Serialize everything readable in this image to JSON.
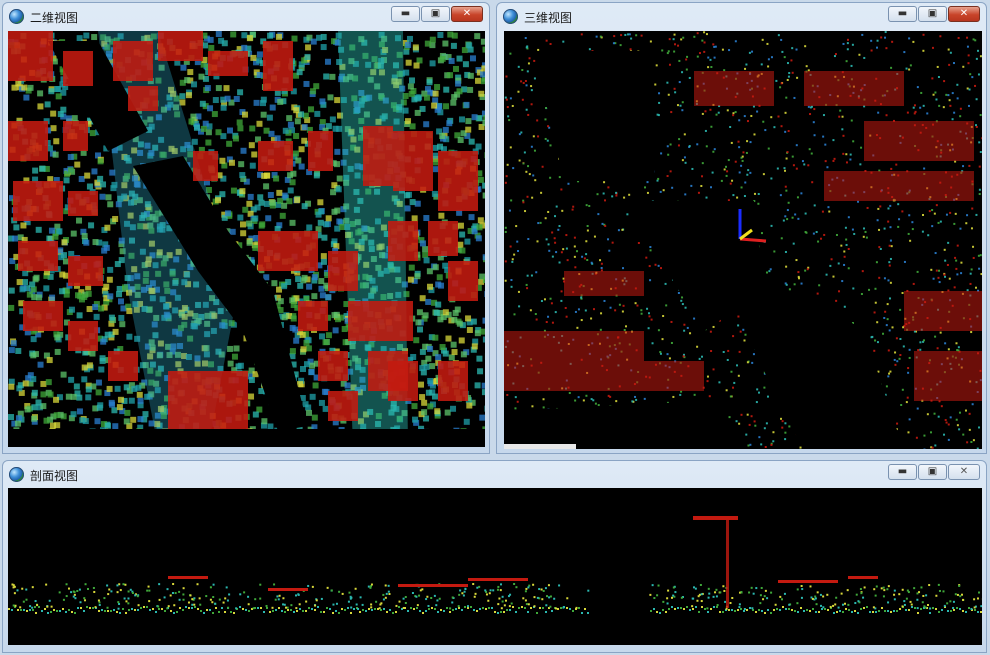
{
  "windows": {
    "view2d": {
      "title": "二维视图"
    },
    "view3d": {
      "title": "三维视图"
    },
    "profile": {
      "title": "剖面视图"
    }
  },
  "buttons": {
    "minimize": "▬",
    "restore": "▣",
    "close": "✕"
  },
  "colors": {
    "building": "#c41a10",
    "ground_green": "#3fa83a",
    "ground_cyan": "#2bb8b0",
    "ground_blue": "#2a7fd0",
    "yellow": "#d8d83a",
    "water": "#000000"
  },
  "icons": {
    "window_icon": "globe-icon",
    "axis": "axis-gizmo-icon"
  }
}
